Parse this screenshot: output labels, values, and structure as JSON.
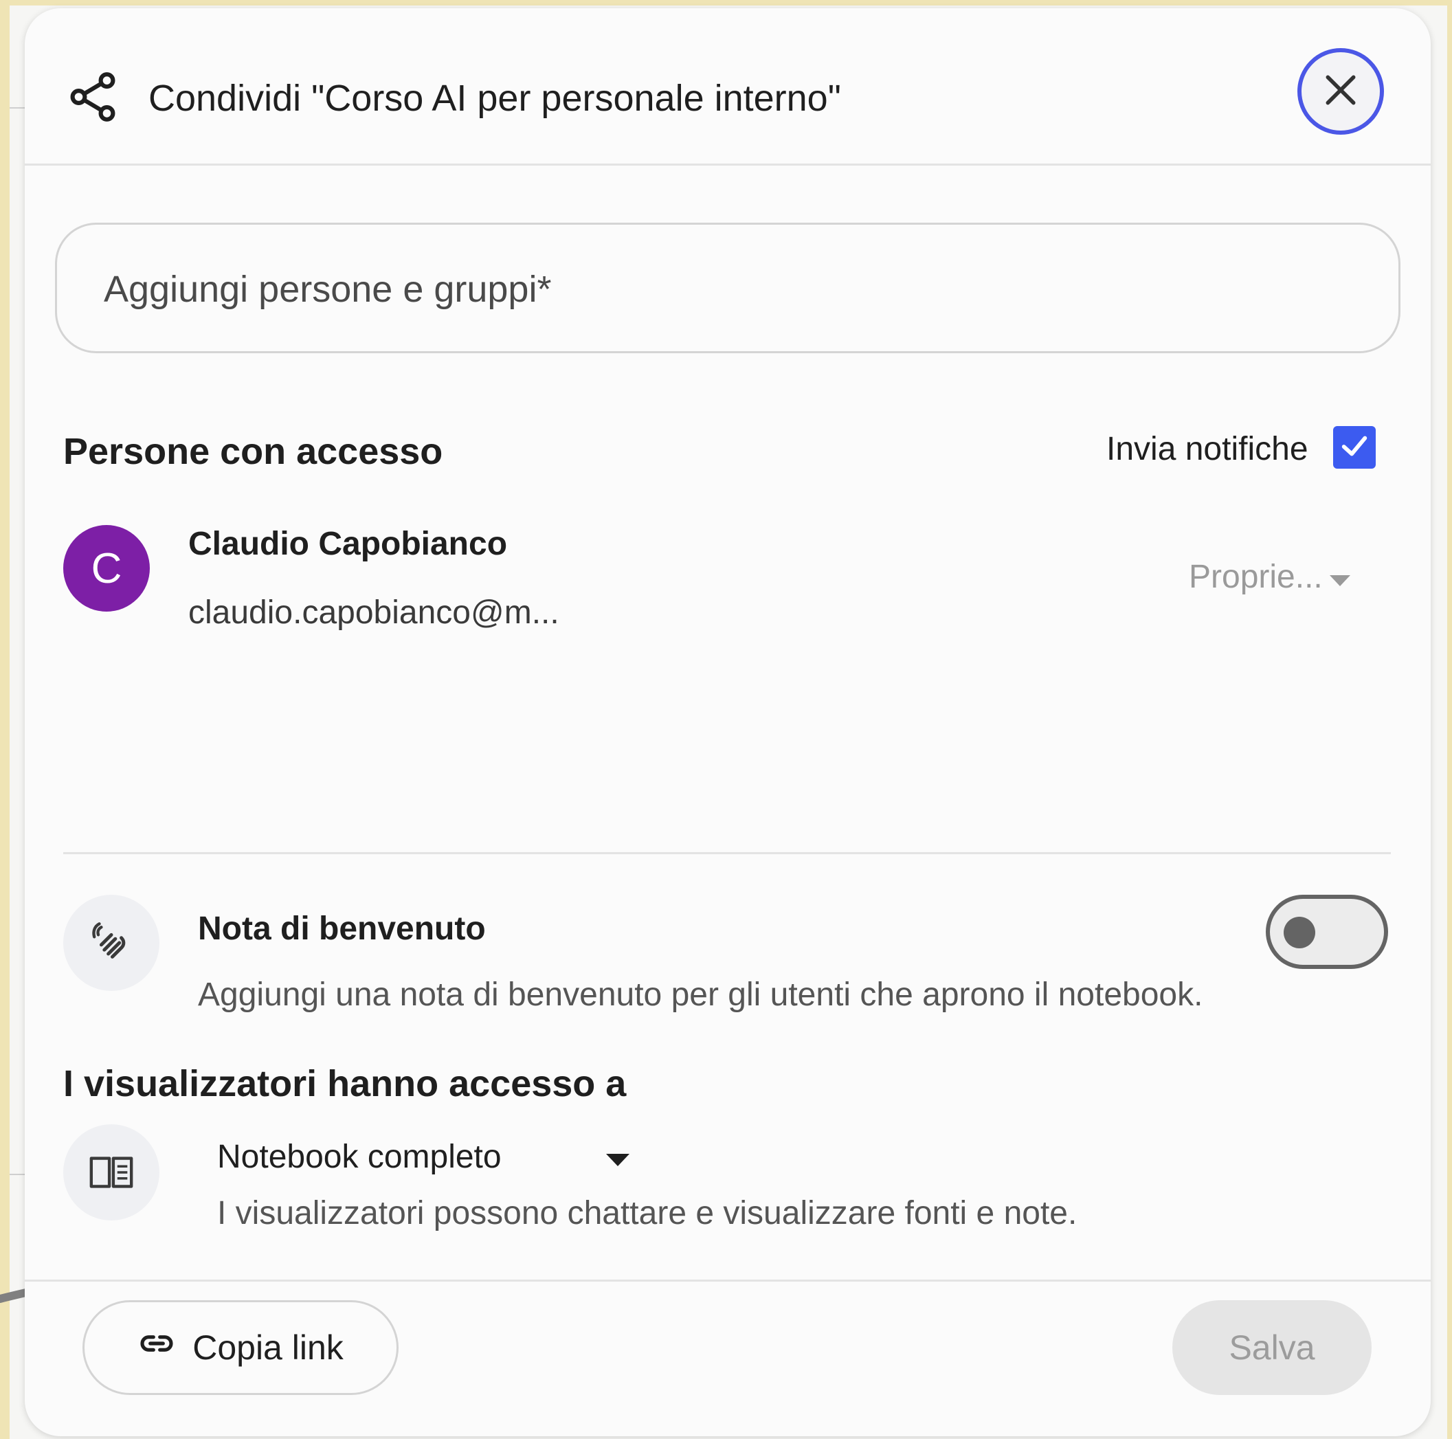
{
  "dialog": {
    "title": "Condividi \"Corso AI per personale interno\"",
    "close_icon": "close-icon",
    "share_icon": "share-icon"
  },
  "search": {
    "placeholder": "Aggiungi persone e gruppi*"
  },
  "access": {
    "section_title": "Persone con accesso",
    "notify_label": "Invia notifiche",
    "notify_checked": true,
    "users": [
      {
        "avatar_letter": "C",
        "avatar_color": "#7d1fa6",
        "name": "Claudio Capobianco",
        "email": "claudio.capobianco@m...",
        "role": "Proprie..."
      }
    ]
  },
  "welcome_note": {
    "icon": "waving-hand-icon",
    "title": "Nota di benvenuto",
    "description": "Aggiungi una nota di benvenuto per gli utenti che aprono il notebook.",
    "enabled": false
  },
  "viewers": {
    "section_title": "I visualizzatori hanno accesso a",
    "icon": "book-icon",
    "selected_option": "Notebook completo",
    "description": "I visualizzatori possono chattare e visualizzare fonti e note."
  },
  "footer": {
    "copy_link_label": "Copia link",
    "save_label": "Salva"
  },
  "colors": {
    "accent": "#3c5bf0",
    "close_ring": "#4b57e6",
    "background": "#efe4b5"
  }
}
